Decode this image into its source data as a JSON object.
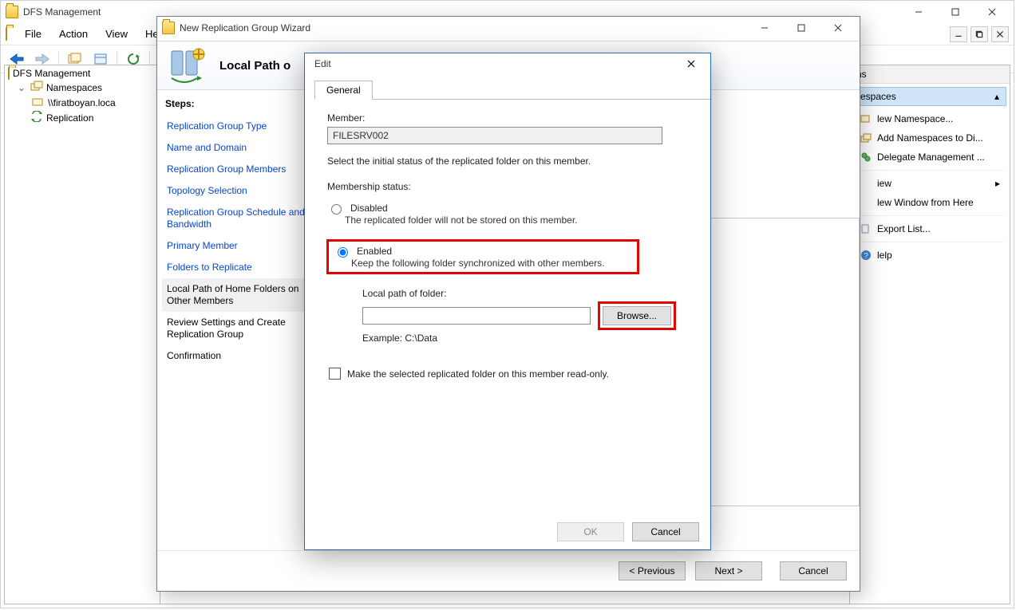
{
  "main": {
    "title": "DFS Management",
    "menu": {
      "file": "File",
      "action": "Action",
      "view": "View",
      "help": "Help"
    },
    "tree": {
      "root": "DFS Management",
      "namespaces": "Namespaces",
      "ns_item": "\\\\firatboyan.loca",
      "replication": "Replication"
    },
    "actions": {
      "pane_title": "ns",
      "section": "espaces",
      "items": {
        "new_namespace": "lew Namespace...",
        "add_namespaces": "Add Namespaces to Di...",
        "delegate": "Delegate Management ...",
        "view": "iew",
        "new_window": "lew Window from Here",
        "export_list": "Export List...",
        "help": "lelp"
      }
    }
  },
  "wizard": {
    "window_title": "New Replication Group Wizard",
    "page_title": "Local Path o",
    "steps_label": "Steps:",
    "steps": {
      "s1": "Replication Group Type",
      "s2": "Name and Domain",
      "s3": "Replication Group Members",
      "s4": "Topology Selection",
      "s5": "Replication Group Schedule and Bandwidth",
      "s6": "Primary Member",
      "s7": "Folders to Replicate",
      "s8": "Local Path of Home Folders on Other Members",
      "s9": "Review Settings and Create Replication Group",
      "s10": "Confirmation"
    },
    "buttons": {
      "previous": "< Previous",
      "next": "Next >",
      "cancel": "Cancel"
    }
  },
  "edit": {
    "title": "Edit",
    "tab": "General",
    "member_label": "Member:",
    "member_value": "FILESRV002",
    "instruction": "Select the initial status of the replicated folder on this member.",
    "status_label": "Membership status:",
    "disabled_label": "Disabled",
    "disabled_desc": "The replicated folder will not be stored on this member.",
    "enabled_label": "Enabled",
    "enabled_desc": "Keep the following folder synchronized with other members.",
    "local_path_label": "Local path of folder:",
    "local_path_value": "",
    "browse": "Browse...",
    "example": "Example: C:\\Data",
    "readonly_label": "Make the selected replicated folder on this member read-only.",
    "ok": "OK",
    "cancel": "Cancel"
  }
}
